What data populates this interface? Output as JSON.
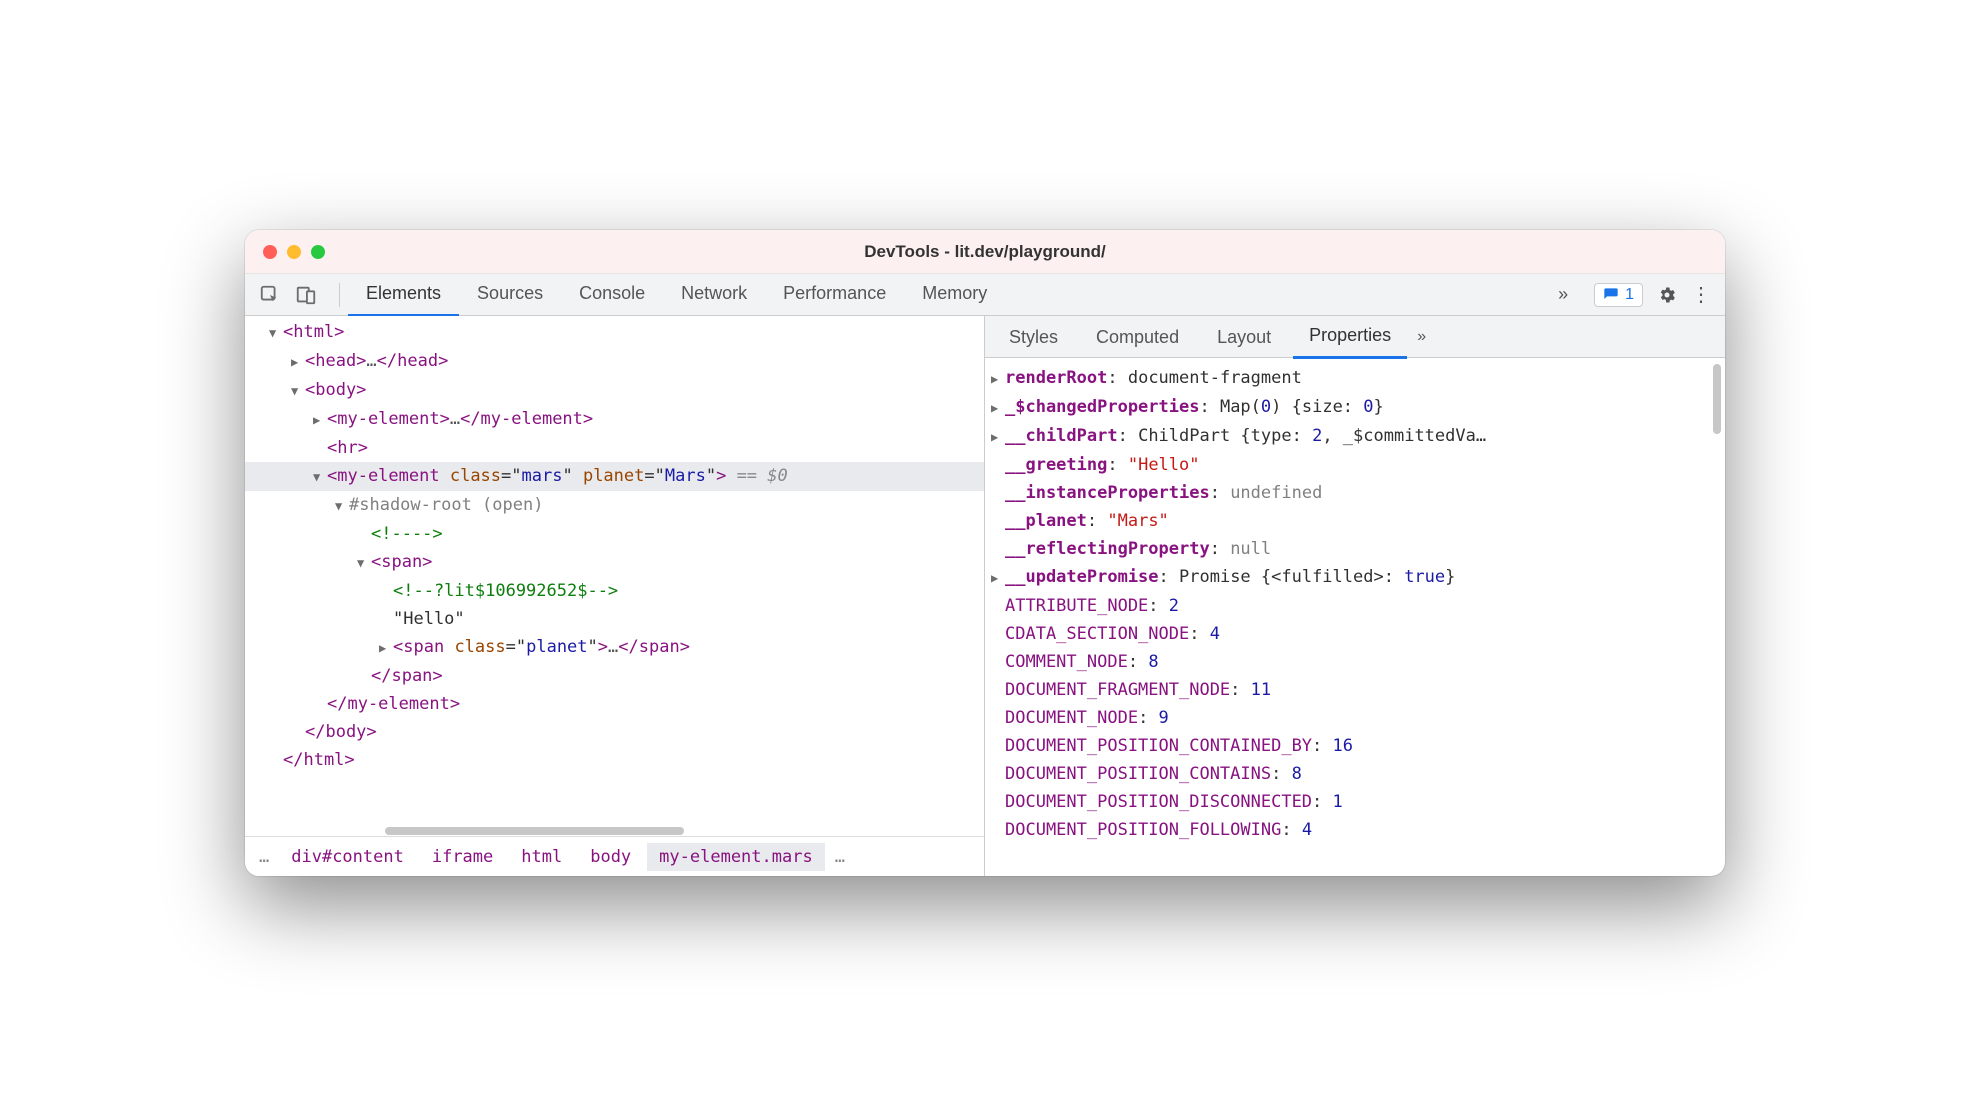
{
  "window": {
    "title": "DevTools - lit.dev/playground/"
  },
  "toolbar": {
    "tabs": [
      "Elements",
      "Sources",
      "Console",
      "Network",
      "Performance",
      "Memory"
    ],
    "overflow": "»",
    "issues_count": "1"
  },
  "dom": {
    "lines": [
      {
        "indent": 0,
        "arrow": "down",
        "html": "<span class='tag'>&lt;html&gt;</span>"
      },
      {
        "indent": 1,
        "arrow": "right",
        "html": "<span class='tag'>&lt;head&gt;</span><span class='dots'>…</span><span class='tag'>&lt;/head&gt;</span>"
      },
      {
        "indent": 1,
        "arrow": "down",
        "html": "<span class='tag'>&lt;body&gt;</span>"
      },
      {
        "indent": 2,
        "arrow": "right",
        "html": "<span class='tag'>&lt;my-element&gt;</span><span class='dots'>…</span><span class='tag'>&lt;/my-element&gt;</span>"
      },
      {
        "indent": 2,
        "arrow": "none",
        "html": "<span class='tag'>&lt;hr&gt;</span>"
      },
      {
        "indent": 2,
        "arrow": "down",
        "selected": true,
        "html": "<span class='tag'>&lt;my-element</span> <span class='attr-name'>class</span>=\"<span class='attr-value'>mars</span>\" <span class='attr-name'>planet</span>=\"<span class='attr-value'>Mars</span>\"<span class='tag'>&gt;</span> <span class='dollar0'>== $0</span>"
      },
      {
        "indent": 3,
        "arrow": "down",
        "html": "<span class='shadow'>#shadow-root (open)</span>"
      },
      {
        "indent": 4,
        "arrow": "none",
        "html": "<span class='comment'>&lt;!----&gt;</span>"
      },
      {
        "indent": 4,
        "arrow": "down",
        "html": "<span class='tag'>&lt;span&gt;</span>"
      },
      {
        "indent": 5,
        "arrow": "none",
        "html": "<span class='comment'>&lt;!--?lit$106992652$--&gt;</span>"
      },
      {
        "indent": 5,
        "arrow": "none",
        "html": "<span class='text-node'>\"Hello\"</span>"
      },
      {
        "indent": 5,
        "arrow": "right",
        "html": "<span class='tag'>&lt;span</span> <span class='attr-name'>class</span>=\"<span class='attr-value'>planet</span>\"<span class='tag'>&gt;</span><span class='dots'>…</span><span class='tag'>&lt;/span&gt;</span>"
      },
      {
        "indent": 4,
        "arrow": "none",
        "html": "<span class='tag'>&lt;/span&gt;</span>"
      },
      {
        "indent": 2,
        "arrow": "none",
        "html": "<span class='tag'>&lt;/my-element&gt;</span>"
      },
      {
        "indent": 1,
        "arrow": "none",
        "html": "<span class='tag'>&lt;/body&gt;</span>"
      },
      {
        "indent": 0,
        "arrow": "none",
        "html": "<span class='tag'>&lt;/html&gt;</span>"
      }
    ]
  },
  "breadcrumbs": {
    "leading": "…",
    "items": [
      "div#content",
      "iframe",
      "html",
      "body",
      "my-element.mars"
    ],
    "selected": "my-element.mars",
    "trailing": "…"
  },
  "subtabs": {
    "items": [
      "Styles",
      "Computed",
      "Layout",
      "Properties"
    ],
    "active": "Properties",
    "overflow": "»"
  },
  "properties": [
    {
      "arrow": "right",
      "key": "renderRoot",
      "bold": true,
      "val": "document-fragment",
      "vtype": "obj"
    },
    {
      "arrow": "right",
      "key": "_$changedProperties",
      "bold": true,
      "val": "Map(0) {size: 0}",
      "vtype": "obj-num"
    },
    {
      "arrow": "right",
      "key": "__childPart",
      "bold": true,
      "val": "ChildPart {type: 2, _$committedVa…",
      "vtype": "obj-num"
    },
    {
      "arrow": "none",
      "key": "__greeting",
      "bold": true,
      "val": "\"Hello\"",
      "vtype": "str"
    },
    {
      "arrow": "none",
      "key": "__instanceProperties",
      "bold": true,
      "val": "undefined",
      "vtype": "undef"
    },
    {
      "arrow": "none",
      "key": "__planet",
      "bold": true,
      "val": "\"Mars\"",
      "vtype": "str"
    },
    {
      "arrow": "none",
      "key": "__reflectingProperty",
      "bold": true,
      "val": "null",
      "vtype": "undef"
    },
    {
      "arrow": "right",
      "key": "__updatePromise",
      "bold": true,
      "val": "Promise {<fulfilled>: true}",
      "vtype": "obj-bool"
    },
    {
      "arrow": "none",
      "key": "ATTRIBUTE_NODE",
      "bold": false,
      "val": "2",
      "vtype": "num"
    },
    {
      "arrow": "none",
      "key": "CDATA_SECTION_NODE",
      "bold": false,
      "val": "4",
      "vtype": "num"
    },
    {
      "arrow": "none",
      "key": "COMMENT_NODE",
      "bold": false,
      "val": "8",
      "vtype": "num"
    },
    {
      "arrow": "none",
      "key": "DOCUMENT_FRAGMENT_NODE",
      "bold": false,
      "val": "11",
      "vtype": "num"
    },
    {
      "arrow": "none",
      "key": "DOCUMENT_NODE",
      "bold": false,
      "val": "9",
      "vtype": "num"
    },
    {
      "arrow": "none",
      "key": "DOCUMENT_POSITION_CONTAINED_BY",
      "bold": false,
      "val": "16",
      "vtype": "num"
    },
    {
      "arrow": "none",
      "key": "DOCUMENT_POSITION_CONTAINS",
      "bold": false,
      "val": "8",
      "vtype": "num"
    },
    {
      "arrow": "none",
      "key": "DOCUMENT_POSITION_DISCONNECTED",
      "bold": false,
      "val": "1",
      "vtype": "num"
    },
    {
      "arrow": "none",
      "key": "DOCUMENT_POSITION_FOLLOWING",
      "bold": false,
      "val": "4",
      "vtype": "num"
    }
  ]
}
